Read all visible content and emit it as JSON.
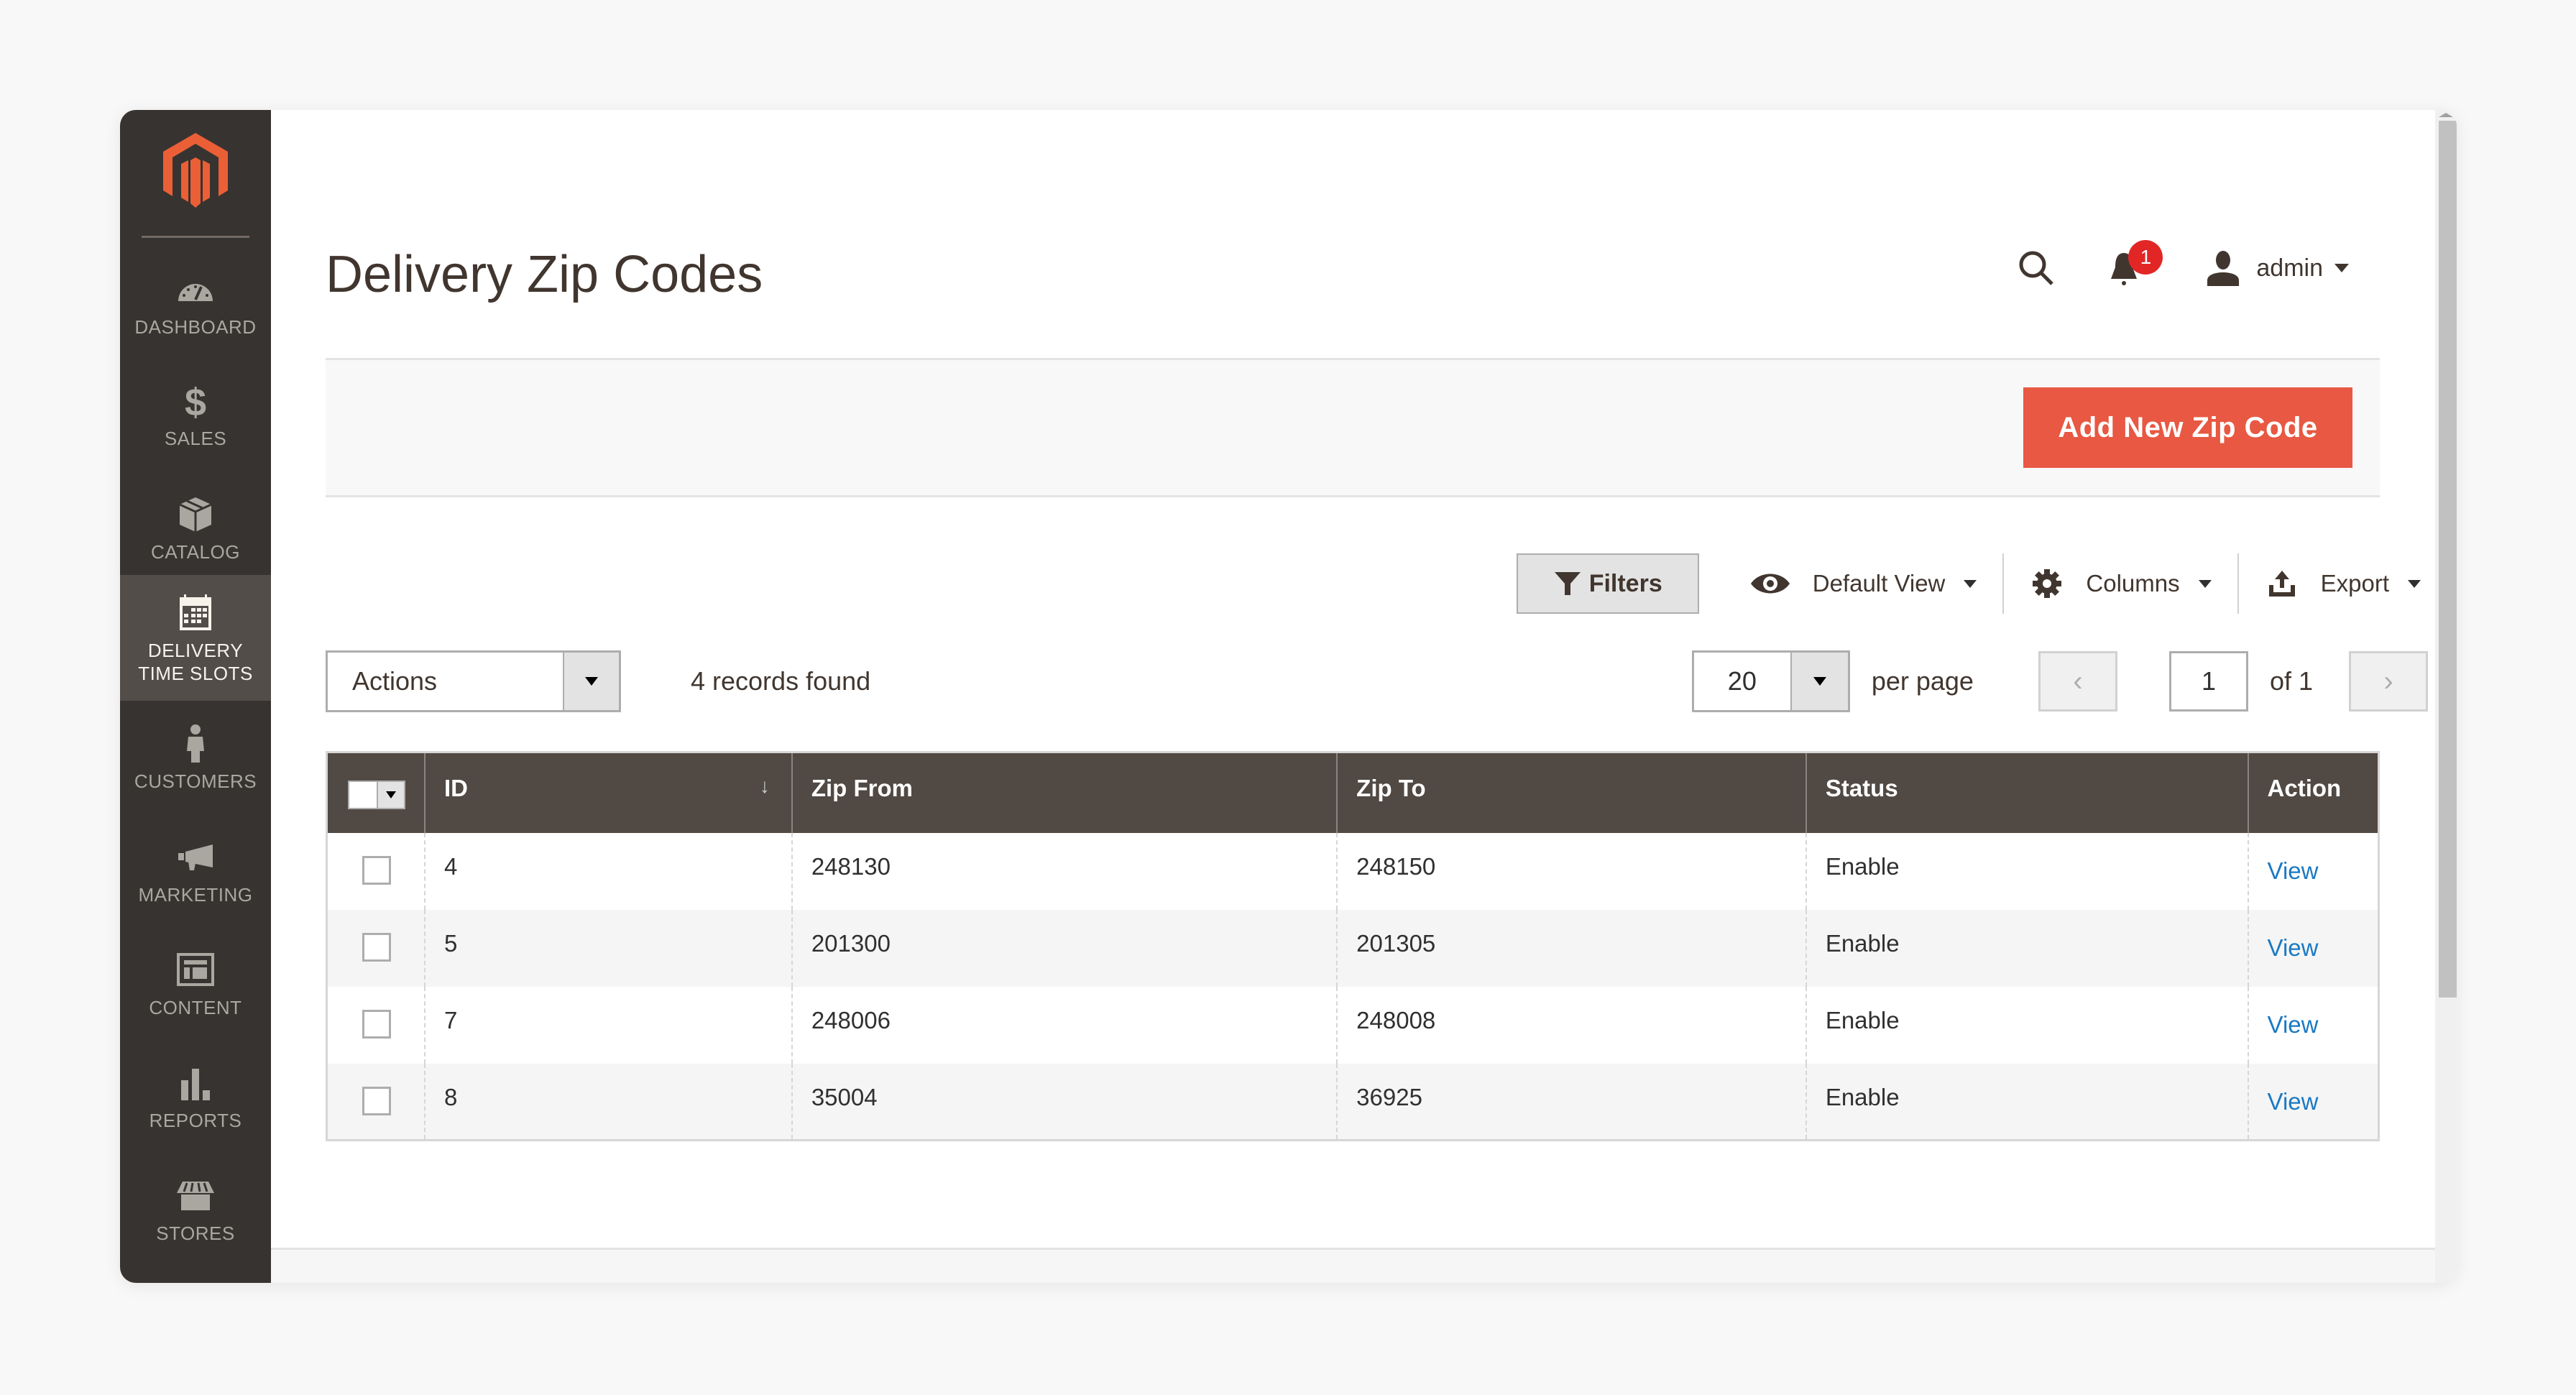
{
  "sidebar": {
    "logo": "magento-logo",
    "items": [
      {
        "label": "Dashboard",
        "icon": "dashboard-icon",
        "active": false
      },
      {
        "label": "Sales",
        "icon": "dollar-icon",
        "active": false
      },
      {
        "label": "Catalog",
        "icon": "box-icon",
        "active": false
      },
      {
        "label": "Delivery Time Slots",
        "icon": "calendar-icon",
        "active": true
      },
      {
        "label": "Customers",
        "icon": "person-icon",
        "active": false
      },
      {
        "label": "Marketing",
        "icon": "megaphone-icon",
        "active": false
      },
      {
        "label": "Content",
        "icon": "layout-icon",
        "active": false
      },
      {
        "label": "Reports",
        "icon": "bar-chart-icon",
        "active": false
      },
      {
        "label": "Stores",
        "icon": "storefront-icon",
        "active": false
      }
    ]
  },
  "header": {
    "title": "Delivery Zip Codes",
    "notifications_count": "1",
    "user": "admin"
  },
  "action_bar": {
    "add_button": "Add New Zip Code"
  },
  "toolbar": {
    "filters": "Filters",
    "view": "Default View",
    "columns": "Columns",
    "export": "Export"
  },
  "grid_controls": {
    "actions_label": "Actions",
    "records_found": "4 records found",
    "per_page_value": "20",
    "per_page_label": "per page",
    "current_page": "1",
    "page_of": "of 1",
    "prev": "‹",
    "next": "›"
  },
  "table": {
    "columns": [
      "ID",
      "Zip From",
      "Zip To",
      "Status",
      "Action"
    ],
    "sort_indicator": "↓",
    "rows": [
      {
        "id": "4",
        "zip_from": "248130",
        "zip_to": "248150",
        "status": "Enable",
        "action": "View"
      },
      {
        "id": "5",
        "zip_from": "201300",
        "zip_to": "201305",
        "status": "Enable",
        "action": "View"
      },
      {
        "id": "7",
        "zip_from": "248006",
        "zip_to": "248008",
        "status": "Enable",
        "action": "View"
      },
      {
        "id": "8",
        "zip_from": "35004",
        "zip_to": "36925",
        "status": "Enable",
        "action": "View"
      }
    ]
  },
  "colors": {
    "sidebar_bg": "#373330",
    "sidebar_active": "#524d49",
    "accent": "#e85842",
    "table_header": "#514943",
    "link": "#1979c3",
    "badge": "#e22626"
  }
}
